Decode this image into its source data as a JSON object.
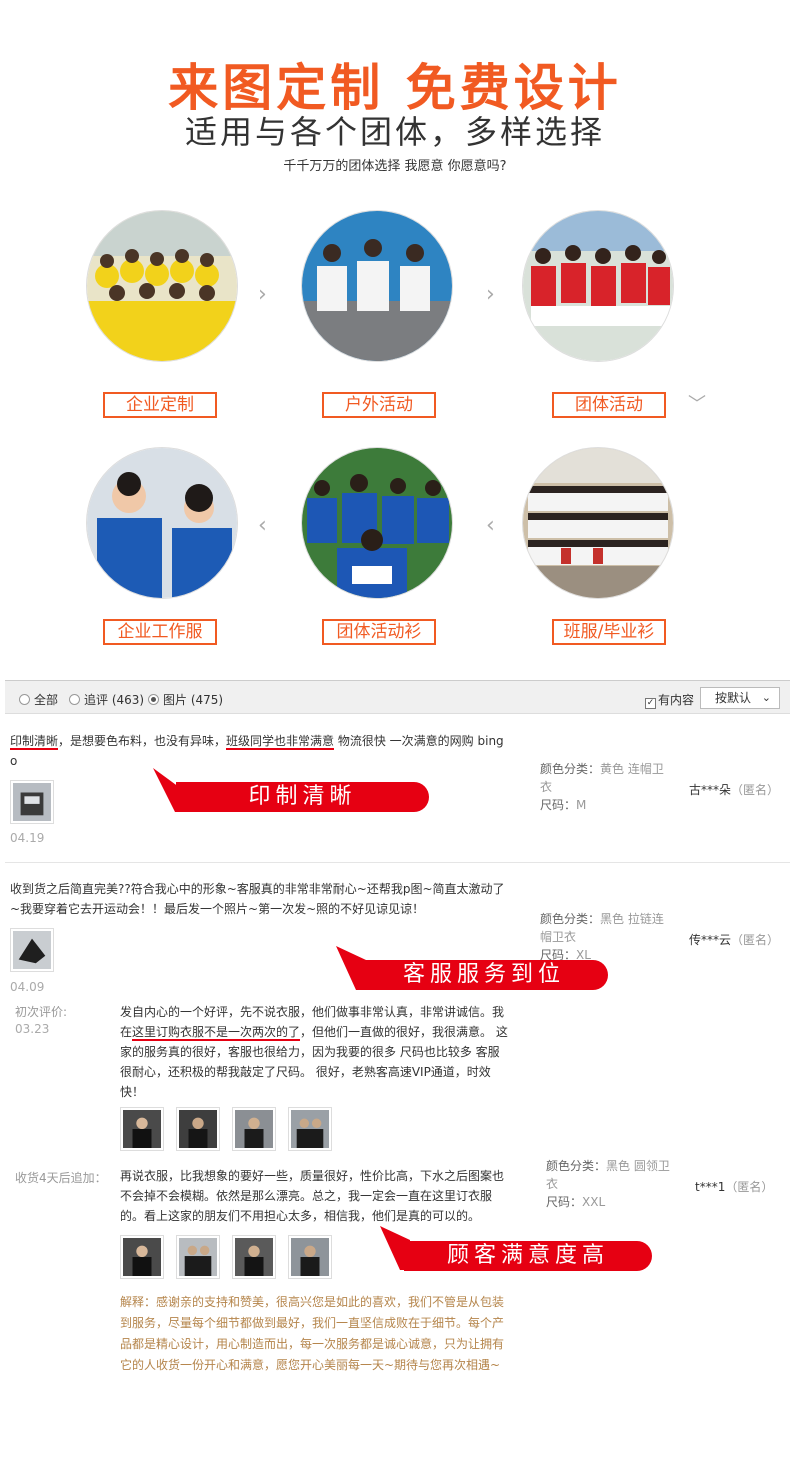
{
  "header": {
    "title": "来图定制  免费设计",
    "subtitle": "适用与各个团体，多样选择",
    "tagline": "千千万万的团体选择  我愿意  你愿意吗?"
  },
  "categories": [
    {
      "label": "企业定制",
      "scene": "yellow-group-photo"
    },
    {
      "label": "户外活动",
      "scene": "white-tshirt-group-photo"
    },
    {
      "label": "团体活动",
      "scene": "red-uniform-group-photo"
    },
    {
      "label": "企业工作服",
      "scene": "blue-polo-staff-photo"
    },
    {
      "label": "团体活动衫",
      "scene": "blue-sports-team-photo"
    },
    {
      "label": "班服/毕业衫",
      "scene": "class-graduation-photo"
    }
  ],
  "filter": {
    "all": "全部",
    "followup": "追评 (463)",
    "pictures": "图片 (475)",
    "has_content": "有内容",
    "sort": "按默认"
  },
  "reviews": [
    {
      "text_u1": "印制清晰",
      "text_mid": "，是想要色布料，也没有异味，",
      "text_u2": "班级同学也非常满意",
      "text_end": " 物流很快 一次满意的网购 bing",
      "text_wrap": "o",
      "color_label": "颜色分类：",
      "color_value": "黄色 连帽卫",
      "color_value2": "衣",
      "size_label": "尺码：",
      "size_value": "M",
      "user": "古***朵",
      "anon": "（匿名）",
      "date": "04.19",
      "banner": "印制清晰"
    },
    {
      "line1": "收到货之后简直完美??符合我心中的形象~客服真的非常非常耐心~还帮我p图~简直太激动了",
      "line2": "~我要穿着它去开运动会！！最后发一个照片~第一次发~照的不好见谅见谅！",
      "color_label": "颜色分类：",
      "color_value": "黑色 拉链连",
      "color_value2": "帽卫衣",
      "size_label": "尺码：",
      "size_value": "XL",
      "user": "传***云",
      "anon": "（匿名）",
      "date": "04.09",
      "banner": "客服服务到位"
    },
    {
      "first_label": "初次评价:",
      "first_date": "03.23",
      "first_l1": "发自内心的一个好评，先不说衣服，他们做事非常认真，非常讲诚信。我",
      "first_l2a": "在",
      "first_l2u": "这里订购衣服不是一次两次的了",
      "first_l2b": "，但他们一直做的很好，我很满意。 这",
      "first_l3": "家的服务真的很好，客服也很给力，因为我要的很多 尺码也比较多 客服",
      "first_l4": "很耐心，还积极的帮我敲定了尺码。 很好，老熟客高速VIP通道，时效",
      "first_l5": "快！",
      "add_label": "收货4天后追加：",
      "add_l1": "再说衣服，比我想象的要好一些，质量很好，性价比高，下水之后图案也",
      "add_l2": "不会掉不会模糊。依然是那么漂亮。总之，我一定会一直在这里订衣服",
      "add_l3": "的。看上这家的朋友们不用担心太多，相信我，他们是真的可以的。",
      "color_label": "颜色分类：",
      "color_value": "黑色 圆领卫",
      "color_value2": "衣",
      "size_label": "尺码：",
      "size_value": "XXL",
      "user": "t***1",
      "anon": "（匿名）",
      "banner": "顾客满意度高",
      "explain_l1": "解释：感谢亲的支持和赞美，很高兴您是如此的喜欢，我们不管是从包装",
      "explain_l2": "到服务，尽量每个细节都做到最好，我们一直坚信成败在于细节。每个产",
      "explain_l3": "品都是精心设计，用心制造而出，每一次服务都是诚心诚意，只为让拥有",
      "explain_l4": "它的人收货一份开心和满意，愿您开心美丽每一天~期待与您再次相遇~"
    }
  ],
  "colors": {
    "accent": "#f15a22",
    "banner": "#e60012",
    "explain": "#b5854b"
  }
}
